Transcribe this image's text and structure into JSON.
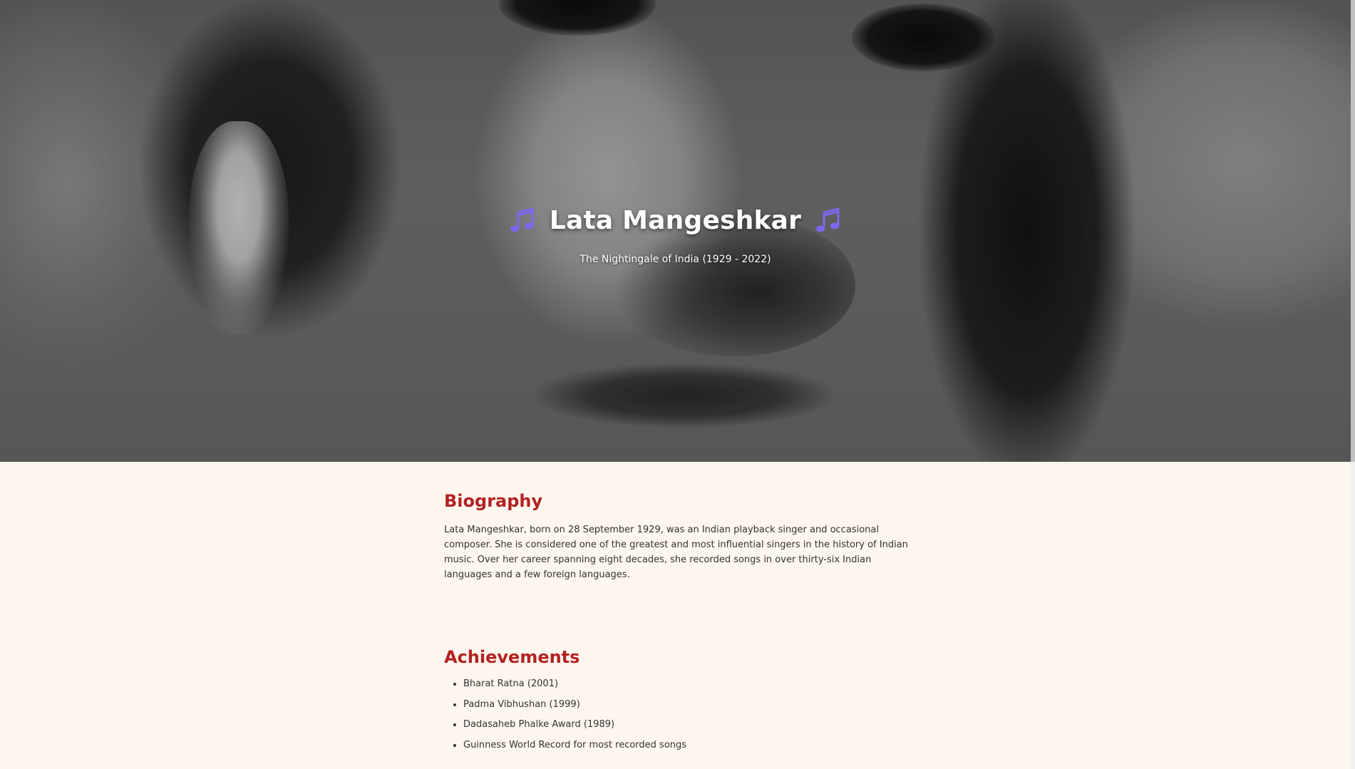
{
  "hero": {
    "title": "Lata Mangeshkar",
    "subtitle": "The Nightingale of India (1929 - 2022)",
    "left_icon": "musical-notes-icon",
    "right_icon": "musical-notes-icon"
  },
  "biography": {
    "heading": "Biography",
    "text": "Lata Mangeshkar, born on 28 September 1929, was an Indian playback singer and occasional composer. She is considered one of the greatest and most influential singers in the history of Indian music. Over her career spanning eight decades, she recorded songs in over thirty-six Indian languages and a few foreign languages."
  },
  "achievements": {
    "heading": "Achievements",
    "items": [
      "Bharat Ratna (2001)",
      "Padma Vibhushan (1999)",
      "Dadasaheb Phalke Award (1989)",
      "Guinness World Record for most recorded songs"
    ]
  },
  "colors": {
    "accent": "#b22222",
    "page_background": "#fdf6ee",
    "text": "#333333",
    "note_icon": "#7b68ee"
  }
}
